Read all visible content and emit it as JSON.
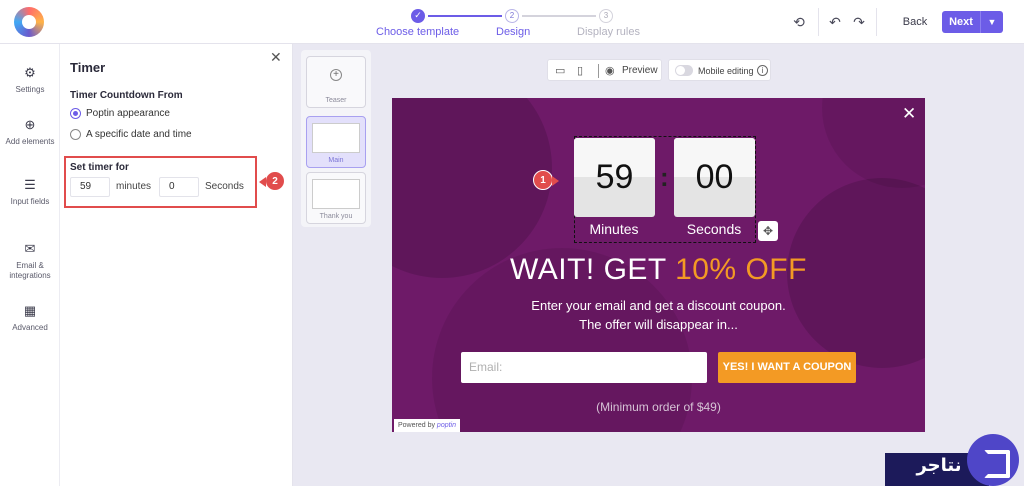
{
  "steps": [
    {
      "label": "Choose template",
      "number": "✓"
    },
    {
      "label": "Design",
      "number": "2"
    },
    {
      "label": "Display rules",
      "number": "3"
    }
  ],
  "toolbar": {
    "back_label": "Back",
    "next_label": "Next"
  },
  "rail": [
    {
      "label": "Settings",
      "icon": "gear-icon"
    },
    {
      "label": "Add elements",
      "icon": "plus-circle-icon"
    },
    {
      "label": "Input fields",
      "icon": "input-fields-icon"
    },
    {
      "label": "Email & integrations",
      "icon": "mail-icon"
    },
    {
      "label": "Advanced",
      "icon": "grid-icon"
    }
  ],
  "panel": {
    "title": "Timer",
    "countdown_title": "Timer Countdown From",
    "options": [
      "Poptin appearance",
      "A specific date and time"
    ],
    "selected_option": "Poptin appearance",
    "set_timer_label": "Set timer for",
    "minutes_value": "59",
    "minutes_unit": "minutes",
    "seconds_value": "0",
    "seconds_unit": "Seconds"
  },
  "annotations": {
    "badge_1": "1",
    "badge_2": "2",
    "color": "#e14c4c"
  },
  "templates": [
    "Teaser",
    "Main",
    "Thank you"
  ],
  "preview": {
    "preview_label": "Preview",
    "mobile_editing_label": "Mobile editing"
  },
  "popup": {
    "minutes": "59",
    "seconds": "00",
    "minutes_label": "Minutes",
    "seconds_label": "Seconds",
    "headline_main": "WAIT! GET ",
    "headline_accent": "10% OFF",
    "sub_line_1": "Enter your email and get a discount coupon.",
    "sub_line_2": "The offer will disappear in...",
    "email_placeholder": "Email:",
    "cta_label": "YES! I WANT A COUPON",
    "note": "(Minimum order of $49)",
    "powered_by": "Powered by",
    "powered_brand": "poptin",
    "colors": {
      "background": "#6e1a68",
      "accent": "#f39a24"
    }
  },
  "watermark": {
    "text": "نتاجر"
  },
  "colors": {
    "primary": "#6c5ce7"
  }
}
